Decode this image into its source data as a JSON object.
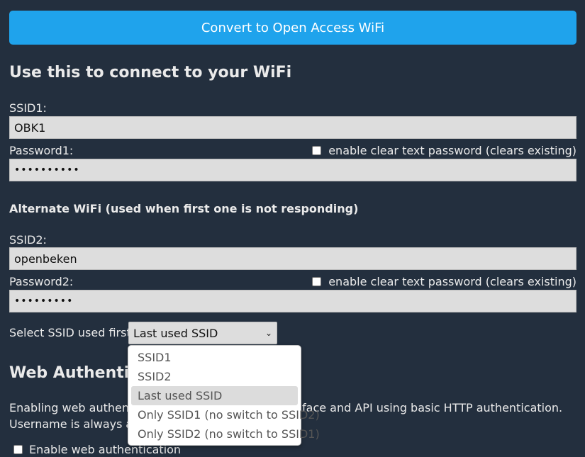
{
  "convert_button": "Convert to Open Access WiFi",
  "wifi_section": {
    "title": "Use this to connect to your WiFi",
    "ssid1_label": "SSID1:",
    "ssid1_value": "OBK1",
    "password1_label": "Password1:",
    "password1_value": "••••••••••",
    "clear_text_label": "enable clear text password (clears existing)"
  },
  "alternate_section": {
    "title": "Alternate WiFi (used when first one is not responding)",
    "ssid2_label": "SSID2:",
    "ssid2_value": "openbeken",
    "password2_label": "Password2:",
    "password2_value": "•••••••••",
    "clear_text_label": "enable clear text password (clears existing)"
  },
  "select_ssid": {
    "label": "Select SSID used first:",
    "selected": "Last used SSID",
    "options": [
      "SSID1",
      "SSID2",
      "Last used SSID",
      "Only SSID1 (no switch to SSID2)",
      "Only SSID2 (no switch to SSID1)"
    ]
  },
  "web_auth": {
    "title_visible": "Web Authenti",
    "desc_line1_left": "Enabling web authenti",
    "desc_line1_right": "face and API using basic HTTP authentication.",
    "desc_line2_left": "Username is always ",
    "desc_line2_bold": "ad",
    "checkbox_label": "Enable web authentication"
  }
}
